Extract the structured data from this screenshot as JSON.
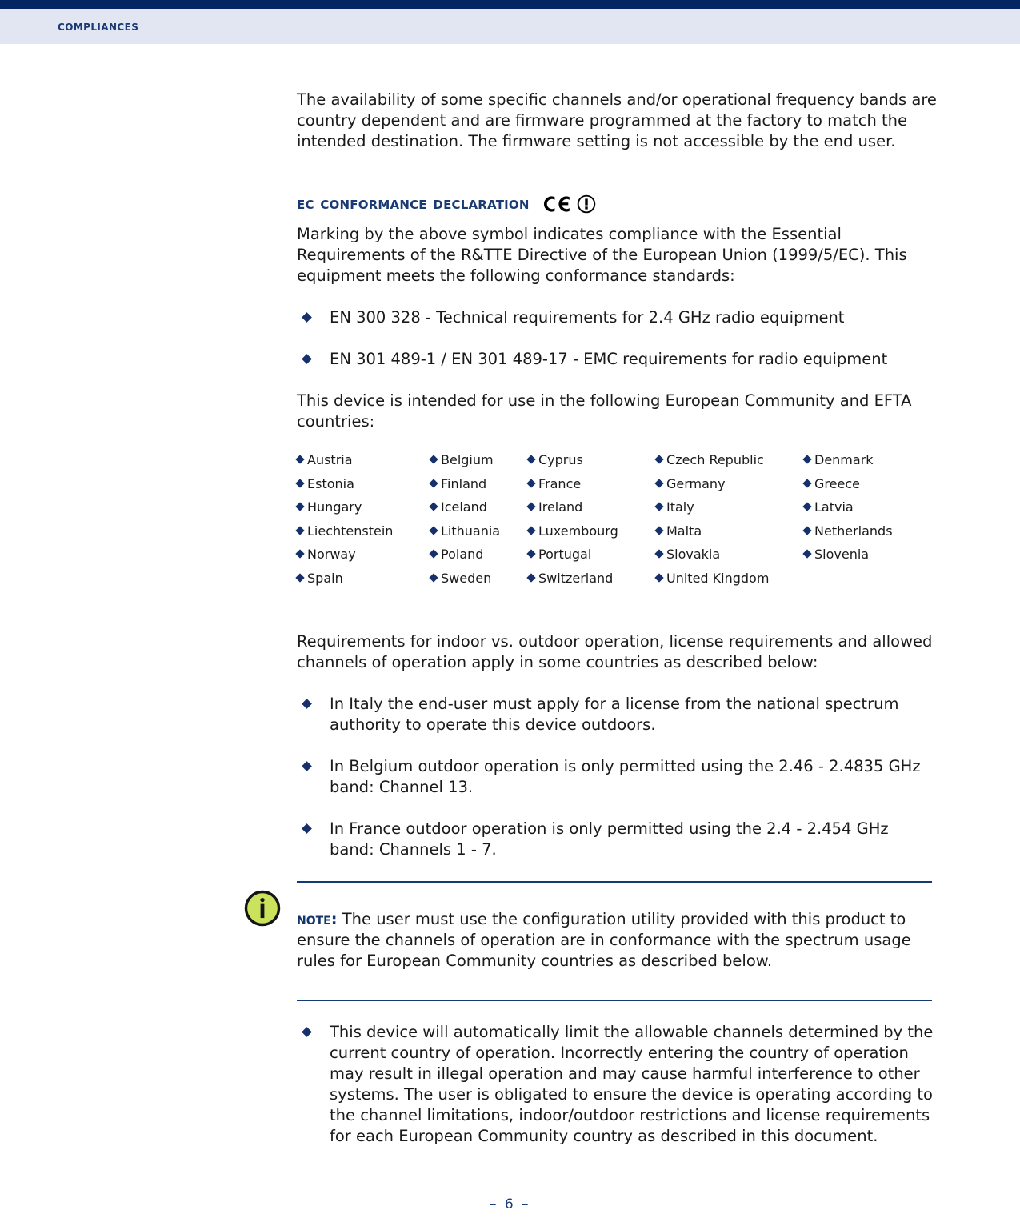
{
  "header": {
    "title": "Compliances"
  },
  "intro": {
    "paragraph": "The availability of some specific channels and/or operational frequency bands are country dependent and are firmware programmed at the factory to match the intended destination. The firmware setting is not accessible by the end user."
  },
  "ec_section": {
    "heading": "EC Conformance Declaration",
    "marks": [
      "ce-mark-icon",
      "alert-circle-icon"
    ],
    "paragraph": "Marking by the above symbol indicates compliance with the Essential Requirements of the R&TTE Directive of the European Union (1999/5/EC). This equipment meets the following conformance standards:",
    "standards": [
      "EN 300 328 - Technical requirements for 2.4 GHz radio equipment",
      "EN 301 489-1 / EN 301 489-17 - EMC requirements for radio equipment"
    ],
    "countries_intro": "This device is intended for use in the following European Community and EFTA countries:",
    "countries": [
      "Austria",
      "Belgium",
      "Cyprus",
      "Czech Republic",
      "Denmark",
      "Estonia",
      "Finland",
      "France",
      "Germany",
      "Greece",
      "Hungary",
      "Iceland",
      "Ireland",
      "Italy",
      "Latvia",
      "Liechtenstein",
      "Lithuania",
      "Luxembourg",
      "Malta",
      "Netherlands",
      "Norway",
      "Poland",
      "Portugal",
      "Slovakia",
      "Slovenia",
      "Spain",
      "Sweden",
      "Switzerland",
      "United Kingdom",
      ""
    ],
    "requirements_intro": "Requirements for indoor vs. outdoor operation, license requirements and allowed channels of operation apply in some countries as described below:",
    "requirements": [
      "In Italy the end-user must apply for a license from the national spectrum authority to operate this device outdoors.",
      "In Belgium outdoor operation is only permitted using the 2.46 - 2.4835 GHz band: Channel 13.",
      "In France outdoor operation is only permitted using the 2.4 - 2.454 GHz band: Channels 1 - 7."
    ]
  },
  "note": {
    "icon": "info-circle-icon",
    "label": "Note:",
    "text": "The user must use the configuration utility provided with this product to ensure the channels of operation are in conformance with the spectrum usage rules for European Community countries as described below.",
    "icon_fill": "#cbe35c",
    "rule_color": "#123a74"
  },
  "closing": {
    "bullets": [
      "This device will automatically limit the allowable channels determined by the current country of operation. Incorrectly entering the country of operation may result in illegal operation and may cause harmful interference to other systems. The user is obligated to ensure the device is operating according to the channel limitations, indoor/outdoor restrictions and license requirements for each European Community country as described in this document."
    ]
  },
  "footer": {
    "page_number": "–  6  –"
  },
  "colors": {
    "header_rule": "#032663",
    "header_band": "#e2e6f2",
    "heading_navy": "#1a3a74",
    "bullet_navy": "#16306b"
  }
}
